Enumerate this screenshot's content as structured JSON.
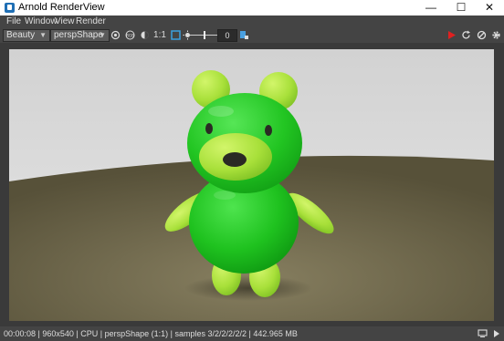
{
  "window": {
    "title": "Arnold RenderView",
    "minimize": "—",
    "maximize": "☐",
    "close": "✕"
  },
  "menu": [
    "File",
    "Window",
    "View",
    "Render"
  ],
  "toolbar": {
    "aov": "Beauty",
    "camera": "perspShape",
    "one_to_one": "1:1",
    "exposure_value": "0",
    "play_icon": "play-icon",
    "colors": {
      "play": "#e02020",
      "crop": "#3aa0e0"
    }
  },
  "status": {
    "text": "00:00:08  |  960x540  |  CPU  |  perspShape (1:1)  |  samples 3/2/2/2/2/2  |  442.965 MB"
  }
}
